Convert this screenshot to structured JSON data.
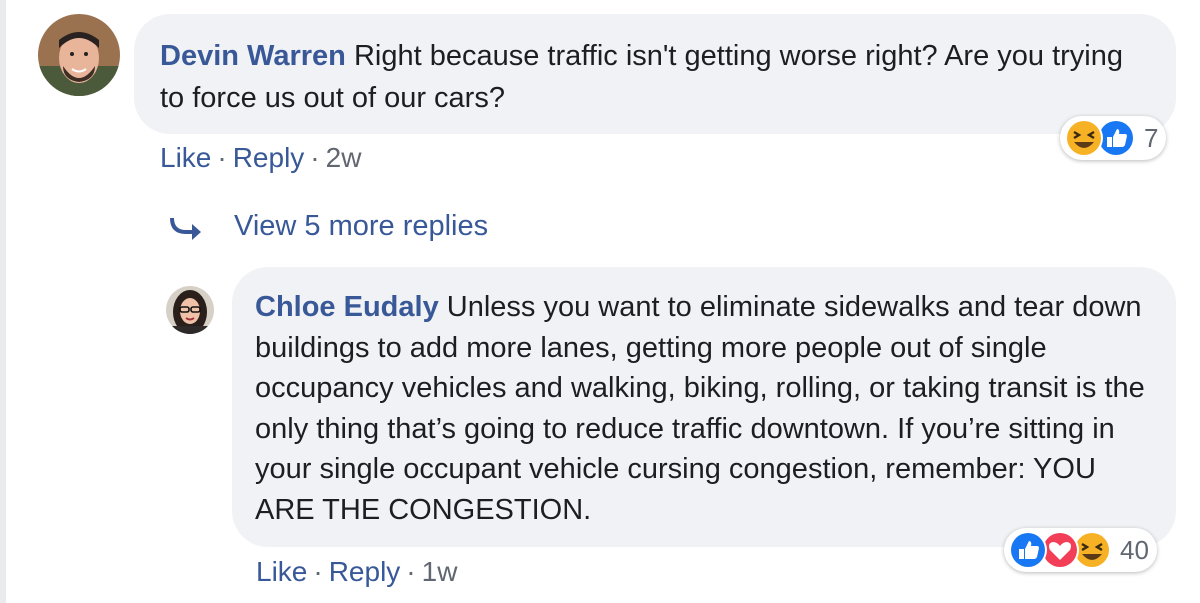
{
  "comments": [
    {
      "author": "Devin Warren",
      "text": "Right because traffic isn't getting worse right? Are you trying to force us out of our cars?",
      "actions": {
        "like": "Like",
        "separator": "·",
        "reply": "Reply",
        "time": "2w"
      },
      "reactions": {
        "icons": [
          "haha-icon",
          "like-icon"
        ],
        "count": "7"
      }
    },
    {
      "author": "Chloe Eudaly",
      "text": "Unless you want to eliminate sidewalks and tear down buildings to add more lanes, getting more people out of single occupancy vehicles and walking, biking, rolling, or taking transit is the only thing that’s going to reduce traffic downtown. If you’re sitting in your single occupant vehicle cursing congestion, remember: YOU ARE THE CONGESTION.",
      "actions": {
        "like": "Like",
        "separator": "·",
        "reply": "Reply",
        "time": "1w"
      },
      "reactions": {
        "icons": [
          "like-icon",
          "love-icon",
          "haha-icon"
        ],
        "count": "40"
      }
    }
  ],
  "view_more": {
    "label": "View 5 more replies",
    "icon": "reply-arrow-icon"
  },
  "colors": {
    "link": "#385898",
    "bubble": "#f0f2f5",
    "meta": "#616770",
    "like_blue": "#1877f2",
    "love_red": "#f33e58",
    "haha_yellow": "#f7b125"
  }
}
